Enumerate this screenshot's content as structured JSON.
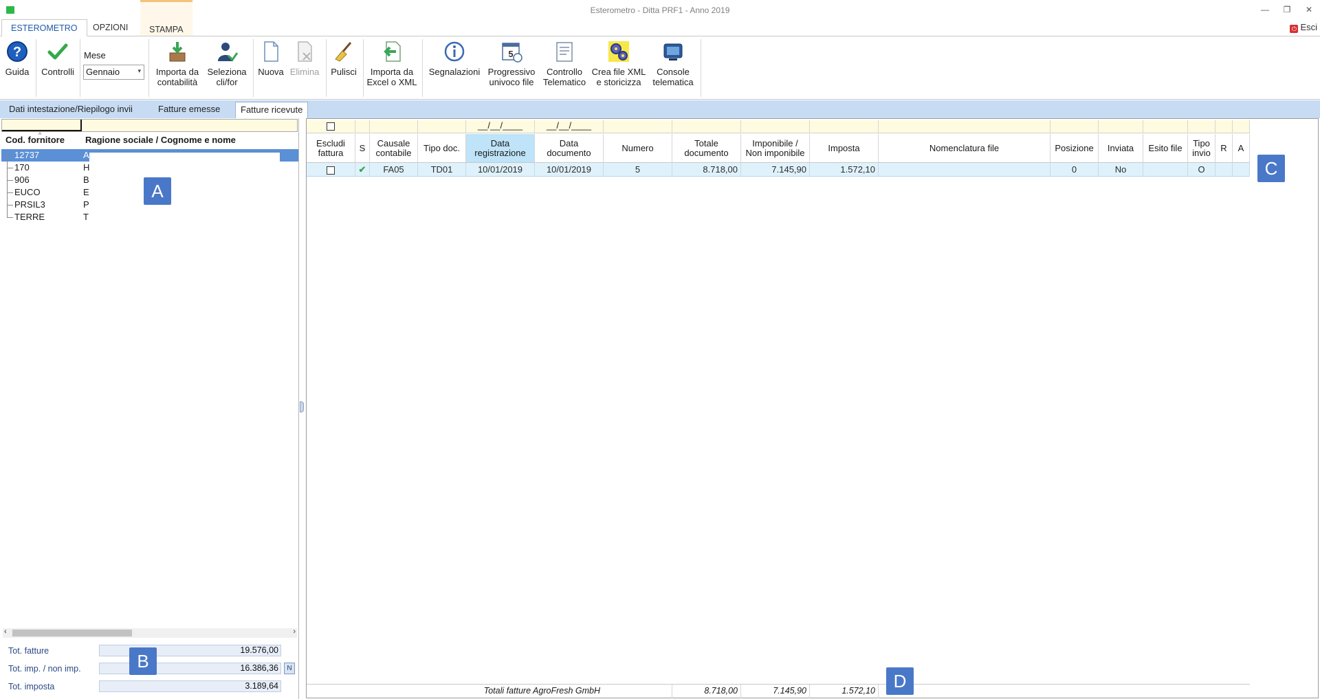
{
  "window": {
    "title": "Esterometro - Ditta PRF1 - Anno 2019",
    "minimize": "—",
    "restore": "❐",
    "close": "✕"
  },
  "ribbon_tabs": [
    "ESTEROMETRO",
    "OPZIONI",
    "STAMPA"
  ],
  "exit_label": "Esci",
  "ribbon": {
    "guida": "Guida",
    "controlli": "Controlli",
    "mese_label": "Mese",
    "mese_value": "Gennaio",
    "importa_contabilita": [
      "Importa da",
      "contabilità"
    ],
    "seleziona": [
      "Seleziona",
      "cli/for"
    ],
    "nuova": "Nuova",
    "elimina": "Elimina",
    "pulisci": "Pulisci",
    "importa_excel": [
      "Importa da",
      "Excel o XML"
    ],
    "segnalazioni": "Segnalazioni",
    "progressivo": [
      "Progressivo",
      "univoco file"
    ],
    "controllo_tel": [
      "Controllo",
      "Telematico"
    ],
    "crea_xml": [
      "Crea file XML",
      "e storicizza"
    ],
    "console": [
      "Console",
      "telematica"
    ]
  },
  "section_tabs": [
    "Dati intestazione/Riepilogo invii",
    "Fatture emesse",
    "Fatture ricevute"
  ],
  "left": {
    "col_code": "Cod. fornitore",
    "col_name": "Ragione sociale / Cognome e nome",
    "rows": [
      {
        "code": "12737",
        "name": "A"
      },
      {
        "code": "170",
        "name": "H"
      },
      {
        "code": "906",
        "name": "B"
      },
      {
        "code": "EUCO",
        "name": "E"
      },
      {
        "code": "PRSIL3",
        "name": "P"
      },
      {
        "code": "TERRE",
        "name": "T"
      }
    ],
    "totals": {
      "tot_fatture_label": "Tot. fatture",
      "tot_fatture": "19.576,00",
      "tot_imp_label": "Tot. imp. / non imp.",
      "tot_imp": "16.386,36",
      "n_button": "N",
      "tot_imposta_label": "Tot. imposta",
      "tot_imposta": "3.189,64"
    }
  },
  "callouts": {
    "a": "A",
    "b": "B",
    "c": "C",
    "d": "D"
  },
  "grid": {
    "date_filter_placeholder": "__/__/____",
    "headers": {
      "escludi": [
        "Escludi",
        "fattura"
      ],
      "s": "S",
      "causale": [
        "Causale",
        "contabile"
      ],
      "tipo_doc": "Tipo doc.",
      "data_reg": [
        "Data",
        "registrazione"
      ],
      "data_doc": [
        "Data",
        "documento"
      ],
      "numero": "Numero",
      "totale": [
        "Totale",
        "documento"
      ],
      "imponibile": [
        "Imponibile /",
        "Non imponibile"
      ],
      "imposta": "Imposta",
      "nomenclatura": "Nomenclatura file",
      "posizione": "Posizione",
      "inviata": "Inviata",
      "esito": "Esito file",
      "tipo_invio": [
        "Tipo",
        "invio"
      ],
      "r": "R",
      "a": "A"
    },
    "row": {
      "causale": "FA05",
      "tipo_doc": "TD01",
      "data_reg": "10/01/2019",
      "data_doc": "10/01/2019",
      "numero": "5",
      "totale": "8.718,00",
      "imponibile": "7.145,90",
      "imposta": "1.572,10",
      "posizione": "0",
      "inviata": "No",
      "tipo_invio": "O"
    },
    "footer": {
      "label": "Totali fatture AgroFresh GmbH",
      "totale": "8.718,00",
      "imponibile": "7.145,90",
      "imposta": "1.572,10"
    }
  }
}
